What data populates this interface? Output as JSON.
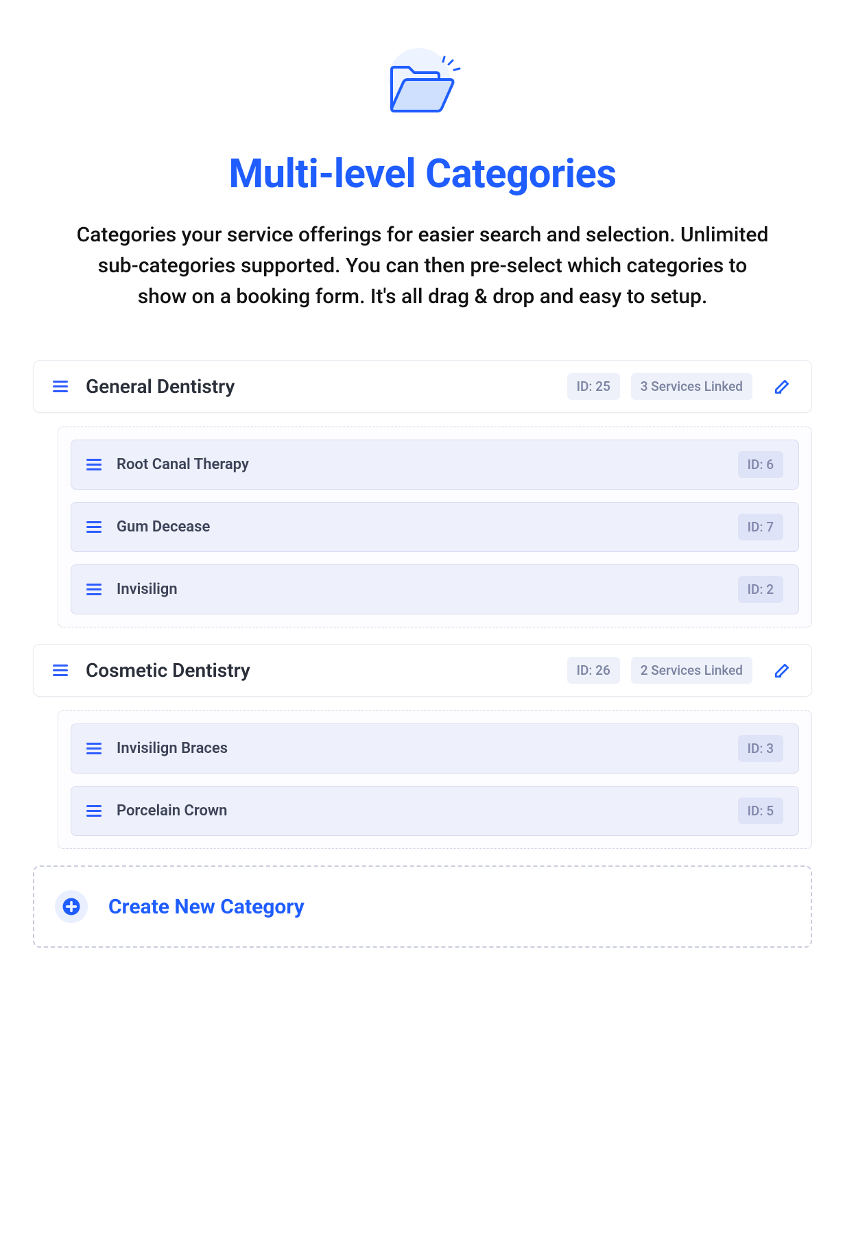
{
  "header": {
    "title": "Multi-level Categories",
    "description": "Categories your service offerings for easier search and selection. Unlimited sub-categories supported. You can then pre-select which categories to show on a booking form. It's all drag & drop and easy to setup."
  },
  "categories": [
    {
      "name": "General Dentistry",
      "id_label": "ID: 25",
      "services_label": "3 Services Linked",
      "subs": [
        {
          "name": "Root Canal Therapy",
          "id_label": "ID: 6"
        },
        {
          "name": "Gum Decease",
          "id_label": "ID: 7"
        },
        {
          "name": "Invisilign",
          "id_label": "ID: 2"
        }
      ]
    },
    {
      "name": "Cosmetic Dentistry",
      "id_label": "ID: 26",
      "services_label": "2 Services Linked",
      "subs": [
        {
          "name": "Invisilign Braces",
          "id_label": "ID: 3"
        },
        {
          "name": "Porcelain Crown",
          "id_label": "ID: 5"
        }
      ]
    }
  ],
  "create": {
    "label": "Create New Category"
  }
}
